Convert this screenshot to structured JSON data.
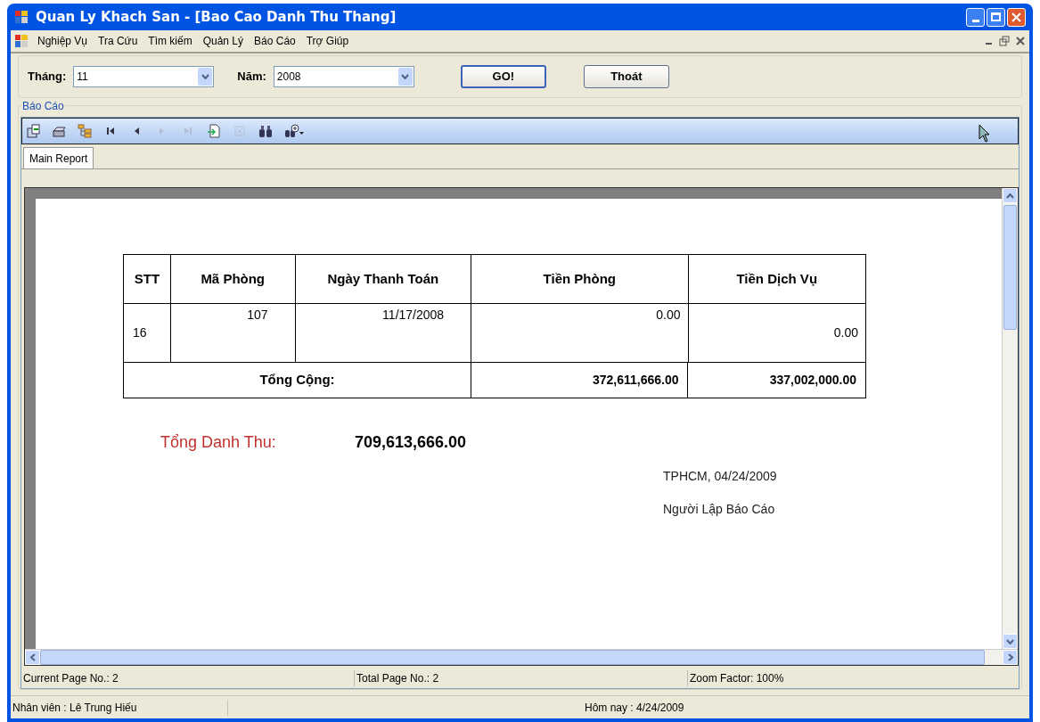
{
  "window": {
    "title": "Quan Ly Khach San - [Bao Cao Danh Thu Thang]"
  },
  "menu": [
    "Nghiệp Vụ",
    "Tra Cứu",
    "Tìm kiếm",
    "Quản Lý",
    "Báo Cáo",
    "Trợ Giúp"
  ],
  "filters": [
    {
      "label": "Tháng:",
      "value": "11"
    },
    {
      "label": "Năm:",
      "value": "2008"
    }
  ],
  "buttons": [
    "GO!",
    "Thoát"
  ],
  "group_label": "Báo Cáo",
  "toolbar": [
    {
      "kind": "export",
      "disabled": false
    },
    {
      "kind": "print",
      "disabled": false
    },
    {
      "kind": "tree",
      "disabled": false
    },
    {
      "kind": "first",
      "disabled": false
    },
    {
      "kind": "prev",
      "disabled": false
    },
    {
      "kind": "next",
      "disabled": true
    },
    {
      "kind": "last",
      "disabled": true
    },
    {
      "kind": "goto",
      "disabled": false
    },
    {
      "kind": "stop",
      "disabled": true
    },
    {
      "kind": "search",
      "disabled": false
    },
    {
      "kind": "zoom",
      "disabled": false
    }
  ],
  "tabs": [
    {
      "label": "Main Report",
      "selected": true
    }
  ],
  "report": {
    "table": {
      "columns": [
        "STT",
        "Mã Phòng",
        "Ngày Thanh Toán",
        "Tiền Phòng",
        "Tiền Dịch Vụ"
      ],
      "rows": [
        [
          "16",
          "107",
          "11/17/2008",
          "0.00",
          "0.00"
        ]
      ],
      "total": {
        "label": "Tổng Cộng:",
        "values": [
          "372,611,666.00",
          "337,002,000.00"
        ]
      }
    },
    "grand_total": {
      "label": "Tổng Danh Thu:",
      "value": "709,613,666.00"
    },
    "place_date": "TPHCM, 04/24/2009",
    "signer": "Người Lập Báo Cáo"
  },
  "viewer_status": [
    "Current Page No.: 2",
    "Total Page No.: 2",
    "Zoom Factor: 100%"
  ],
  "status_bar": [
    "Nhân viên : Lê Trung Hiếu",
    "Hôm nay : 4/24/2009"
  ]
}
